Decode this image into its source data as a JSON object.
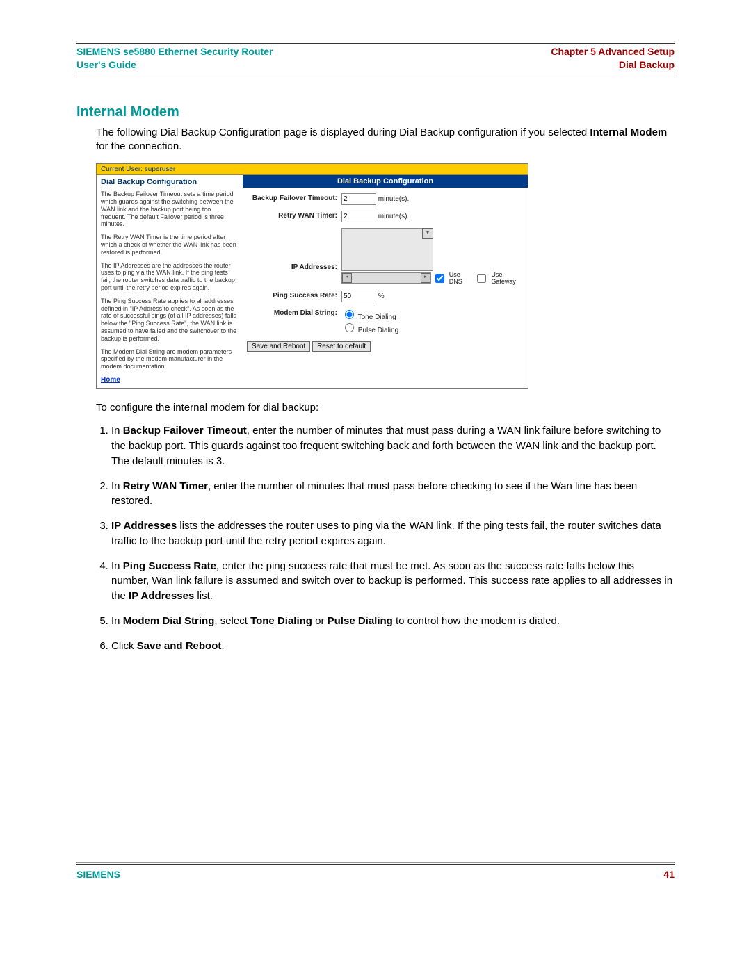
{
  "header": {
    "left_line1": "SIEMENS se5880 Ethernet Security Router",
    "left_line2": "User's Guide",
    "right_line1": "Chapter 5  Advanced Setup",
    "right_line2": "Dial Backup"
  },
  "section_title": "Internal Modem",
  "intro": {
    "line1": "The following Dial Backup Configuration page is displayed during Dial Backup configuration if you selected ",
    "bold": "Internal Modem",
    "after": " for the connection."
  },
  "screenshot": {
    "userbar": "Current User: superuser",
    "left_title": "Dial Backup Configuration",
    "left_paras": [
      "The Backup Failover Timeout sets a time period which guards against the switching between the WAN link and the backup port being too frequent. The default Failover period is three minutes.",
      "The Retry WAN Timer is the time period after which a check of whether the WAN link has been restored is performed.",
      "The IP Addresses are the addresses the router uses to ping via the WAN link. If the ping tests fail, the router switches data traffic to the backup port until the retry period expires again.",
      "The Ping Success Rate applies to all addresses defined in \"IP Address to check\". As soon as the rate of successful pings (of all IP addresses) falls below the \"Ping Success Rate\", the WAN link is assumed to have failed and the switchover to the backup is performed.",
      "The Modem Dial String are modem parameters specified by the modem manufacturer in the modem documentation."
    ],
    "home_link": "Home",
    "panel_title": "Dial Backup Configuration",
    "labels": {
      "failover": "Backup Failover Timeout:",
      "retry": "Retry WAN Timer:",
      "ip": "IP Addresses:",
      "ping": "Ping Success Rate:",
      "dial": "Modem Dial String:"
    },
    "values": {
      "failover_val": "2",
      "failover_unit": "minute(s).",
      "retry_val": "2",
      "retry_unit": "minute(s).",
      "ping_val": "50",
      "ping_unit": "%",
      "tone": "Tone Dialing",
      "pulse": "Pulse Dialing",
      "use_dns": "Use DNS",
      "use_gateway": "Use Gateway"
    },
    "buttons": {
      "save": "Save and Reboot",
      "reset": "Reset to default"
    }
  },
  "configure_line": "To configure the internal modem for dial backup:",
  "steps": {
    "s1_a": "In ",
    "s1_b": "Backup Failover Timeout",
    "s1_c": ", enter the number of minutes that must pass during a WAN link failure before switching to the backup port. This guards against too frequent switching back and forth between the WAN link and the backup port. The default minutes is 3.",
    "s2_a": "In ",
    "s2_b": "Retry WAN Timer",
    "s2_c": ", enter the number of minutes that must pass before checking to see if the Wan line has been restored.",
    "s3_b": "IP Addresses",
    "s3_c": " lists the addresses the router uses to ping via the WAN link. If the ping tests fail, the router switches data traffic to the backup port until the retry period expires again.",
    "s4_a": "In ",
    "s4_b": "Ping Success Rate",
    "s4_c": ", enter the ping success rate that must be met. As soon as the success rate falls below this number, Wan link failure is assumed and switch over to backup is performed. This success rate applies to all addresses in the ",
    "s4_d": "IP Addresses",
    "s4_e": " list.",
    "s5_a": "In ",
    "s5_b": "Modem Dial String",
    "s5_c": ", select ",
    "s5_d": "Tone Dialing",
    "s5_e": " or ",
    "s5_f": "Pulse Dialing",
    "s5_g": " to control how the modem is dialed.",
    "s6_a": "Click ",
    "s6_b": "Save and Reboot",
    "s6_c": "."
  },
  "footer": {
    "brand": "SIEMENS",
    "page": "41"
  }
}
